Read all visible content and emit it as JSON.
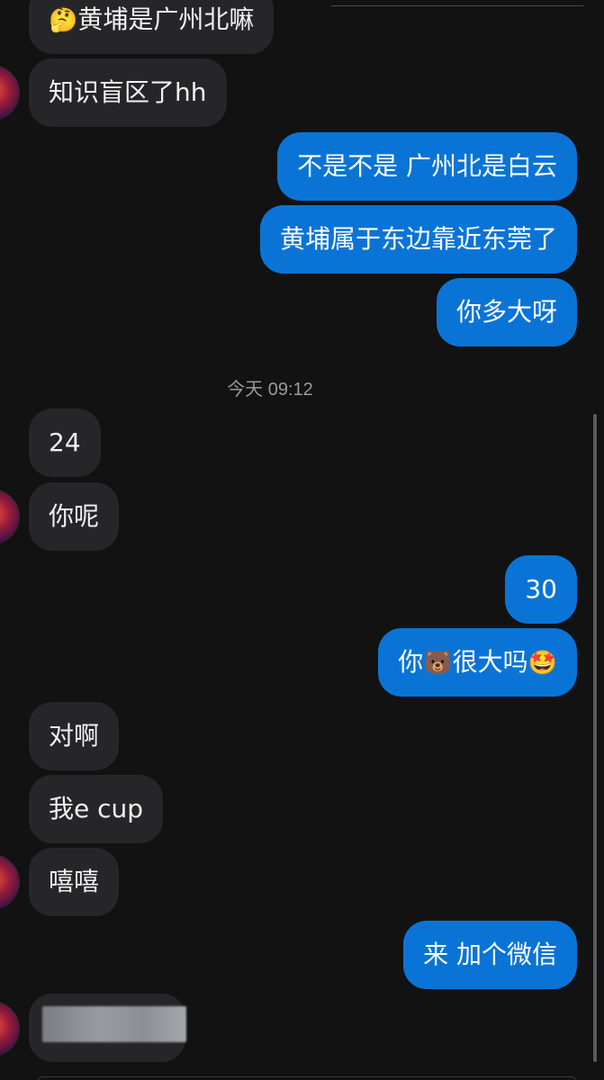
{
  "timestamp": "今天 09:12",
  "messages": [
    {
      "side": "in",
      "text": "黄埔是广州北嘛",
      "emoji": "🤔"
    },
    {
      "side": "in",
      "text": "知识盲区了hh"
    },
    {
      "side": "out",
      "text": "不是不是 广州北是白云"
    },
    {
      "side": "out",
      "text": "黄埔属于东边靠近东莞了"
    },
    {
      "side": "out",
      "text": "你多大呀"
    },
    {
      "side": "in",
      "text": "24"
    },
    {
      "side": "in",
      "text": "你呢"
    },
    {
      "side": "out",
      "text": "30"
    },
    {
      "side": "out",
      "text_a": "你",
      "emoji_a": "🐻",
      "text_b": "很大吗",
      "emoji_b": "🤩"
    },
    {
      "side": "in",
      "text": "对啊"
    },
    {
      "side": "in",
      "text": "我e cup"
    },
    {
      "side": "in",
      "text": "嘻嘻"
    },
    {
      "side": "out",
      "text": "来 加个微信"
    },
    {
      "side": "in",
      "text": ""
    }
  ],
  "colors": {
    "background": "#121212",
    "incoming_bubble": "#262629",
    "outgoing_bubble": "#0a74d6"
  },
  "icons": {
    "avatar": "contact-avatar",
    "thinking": "thinking-face-emoji",
    "bear": "bear-face-emoji",
    "starstruck": "star-struck-emoji"
  }
}
